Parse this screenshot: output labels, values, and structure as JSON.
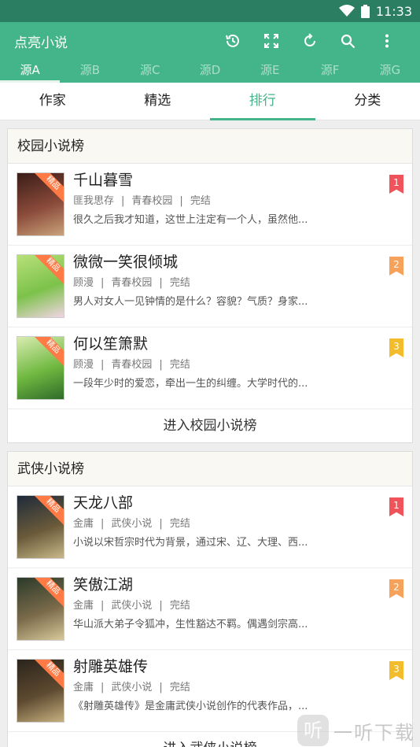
{
  "status": {
    "time": "11:33"
  },
  "toolbar": {
    "title": "点亮小说",
    "actions": [
      "history-icon",
      "fullscreen-icon",
      "refresh-icon",
      "search-icon",
      "more-vert-icon"
    ]
  },
  "sources": [
    {
      "label": "源A",
      "active": true
    },
    {
      "label": "源B"
    },
    {
      "label": "源C"
    },
    {
      "label": "源D"
    },
    {
      "label": "源E"
    },
    {
      "label": "源F"
    },
    {
      "label": "源G"
    }
  ],
  "tabs": [
    {
      "label": "作家"
    },
    {
      "label": "精选"
    },
    {
      "label": "排行",
      "active": true
    },
    {
      "label": "分类"
    }
  ],
  "sections": [
    {
      "title": "校园小说榜",
      "enter_label": "进入校园小说榜",
      "books": [
        {
          "rank": "1",
          "tag": "精品",
          "title": "千山暮雪",
          "author": "匪我思存",
          "category": "青春校园",
          "status": "完结",
          "desc": "很久之后我才知道，这世上注定有一个人，虽然他...",
          "cover_colors": [
            "#3a1d18",
            "#8a4a3a",
            "#c9a27a"
          ]
        },
        {
          "rank": "2",
          "tag": "精品",
          "title": "微微一笑很倾城",
          "author": "顾漫",
          "category": "青春校园",
          "status": "完结",
          "desc": "男人对女人一见钟情的是什么？容貌？气质？身家...",
          "cover_colors": [
            "#b8e07a",
            "#7cc24a",
            "#f2d4e4"
          ]
        },
        {
          "rank": "3",
          "tag": "精品",
          "title": "何以笙箫默",
          "author": "顾漫",
          "category": "青春校园",
          "status": "完结",
          "desc": "一段年少时的爱恋，牵出一生的纠缠。大学时代的...",
          "cover_colors": [
            "#d8ecb0",
            "#6fb840",
            "#2f6b2a"
          ]
        }
      ]
    },
    {
      "title": "武侠小说榜",
      "enter_label": "进入武侠小说榜",
      "books": [
        {
          "rank": "1",
          "tag": "精品",
          "title": "天龙八部",
          "author": "金庸",
          "category": "武侠小说",
          "status": "完结",
          "desc": "小说以宋哲宗时代为背景，通过宋、辽、大理、西...",
          "cover_colors": [
            "#1e2a3a",
            "#6a5a3a",
            "#c8b888"
          ]
        },
        {
          "rank": "2",
          "tag": "精品",
          "title": "笑傲江湖",
          "author": "金庸",
          "category": "武侠小说",
          "status": "完结",
          "desc": "华山派大弟子令狐冲，生性豁达不羁。偶遇剑宗高...",
          "cover_colors": [
            "#2b3a2a",
            "#7a6a4a",
            "#d8c89a"
          ]
        },
        {
          "rank": "3",
          "tag": "精品",
          "title": "射雕英雄传",
          "author": "金庸",
          "category": "武侠小说",
          "status": "完结",
          "desc": "《射雕英雄传》是金庸武侠小说创作的代表作品，...",
          "cover_colors": [
            "#2a241c",
            "#5e4a30",
            "#c6b080"
          ]
        }
      ]
    }
  ],
  "watermark": {
    "logo": "听",
    "text": "一听下载"
  }
}
